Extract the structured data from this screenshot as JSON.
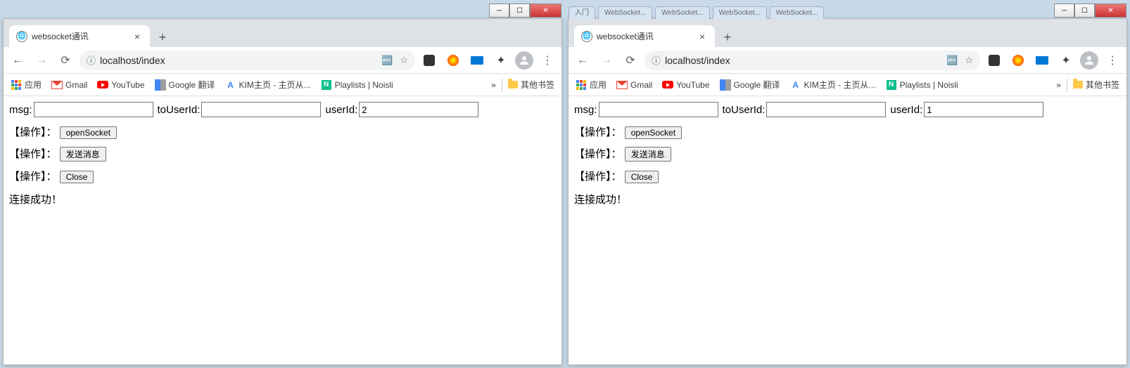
{
  "windows": [
    {
      "tab_title": "websocket通讯",
      "url": "localhost/index",
      "bookmarks": {
        "apps": "应用",
        "gmail": "Gmail",
        "youtube": "YouTube",
        "gtranslate": "Google 翻译",
        "kim": "KIM主页 - 主页从...",
        "noisli": "Playlists | Noisli",
        "overflow": "»",
        "other": "其他书签"
      },
      "page": {
        "msg_label": "msg:",
        "msg_value": "",
        "toUser_label": "toUserId:",
        "toUser_value": "",
        "userId_label": "userId:",
        "userId_value": "2",
        "op_label": "【操作】：",
        "btn_open": "openSocket",
        "btn_send": "发送消息",
        "btn_close": "Close",
        "status": "连接成功！"
      },
      "ghost_tabs": []
    },
    {
      "tab_title": "websocket通讯",
      "url": "localhost/index",
      "bookmarks": {
        "apps": "应用",
        "gmail": "Gmail",
        "youtube": "YouTube",
        "gtranslate": "Google 翻译",
        "kim": "KIM主页 - 主页从...",
        "noisli": "Playlists | Noisli",
        "overflow": "»",
        "other": "其他书签"
      },
      "page": {
        "msg_label": "msg:",
        "msg_value": "",
        "toUser_label": "toUserId:",
        "toUser_value": "",
        "userId_label": "userId:",
        "userId_value": "1",
        "op_label": "【操作】：",
        "btn_open": "openSocket",
        "btn_send": "发送消息",
        "btn_close": "Close",
        "status": "连接成功！"
      },
      "ghost_tabs": [
        "入门",
        "WebSocket...",
        "WebSocket...",
        "WebSocket...",
        "WebSocket..."
      ]
    }
  ]
}
